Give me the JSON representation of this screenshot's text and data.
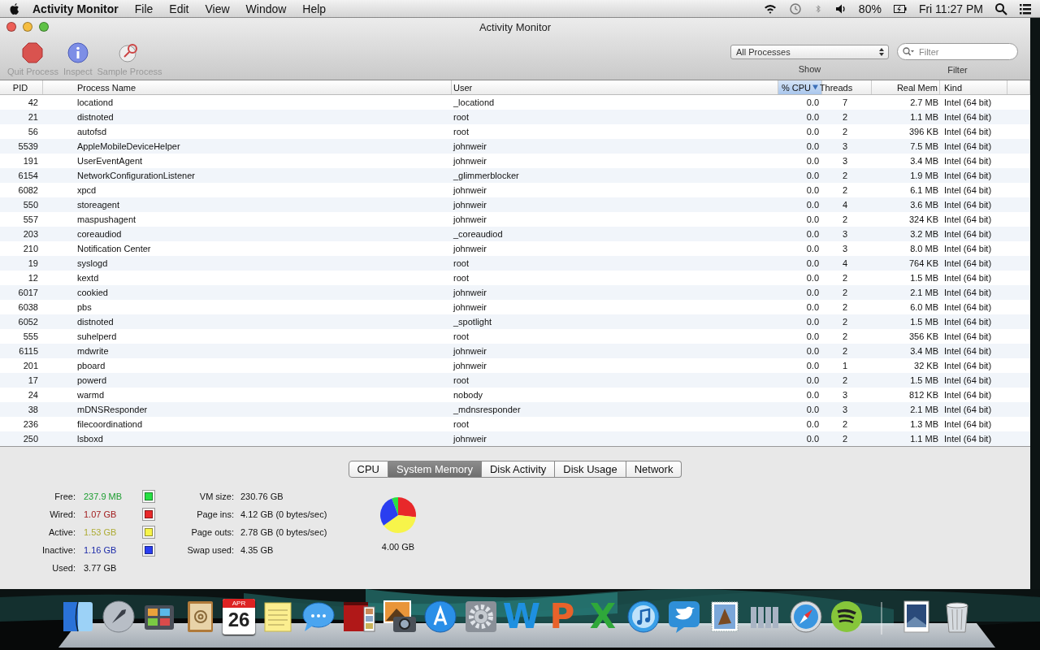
{
  "menu_bar": {
    "app_name": "Activity Monitor",
    "menus": [
      "File",
      "Edit",
      "View",
      "Window",
      "Help"
    ],
    "battery": "80%",
    "clock": "Fri 11:27 PM"
  },
  "window": {
    "title": "Activity Monitor"
  },
  "toolbar": {
    "buttons": [
      {
        "label": "Quit Process",
        "kind": "quit",
        "disabled": true
      },
      {
        "label": "Inspect",
        "kind": "inspect",
        "disabled": true
      },
      {
        "label": "Sample Process",
        "kind": "sample",
        "disabled": true
      }
    ],
    "show": {
      "value": "All Processes",
      "label": "Show"
    },
    "filter": {
      "placeholder": "Filter",
      "label": "Filter"
    }
  },
  "table": {
    "columns": [
      {
        "label": "PID",
        "selected": false
      },
      {
        "label": "Process Name",
        "selected": false
      },
      {
        "label": "User",
        "selected": false
      },
      {
        "label": "% CPU",
        "selected": true
      },
      {
        "label": "Threads",
        "selected": false
      },
      {
        "label": "Real Mem",
        "selected": false
      },
      {
        "label": "Kind",
        "selected": false
      }
    ],
    "rows": [
      [
        "42",
        "locationd",
        "_locationd",
        "0.0",
        "7",
        "2.7 MB",
        "Intel (64 bit)"
      ],
      [
        "21",
        "distnoted",
        "root",
        "0.0",
        "2",
        "1.1 MB",
        "Intel (64 bit)"
      ],
      [
        "56",
        "autofsd",
        "root",
        "0.0",
        "2",
        "396 KB",
        "Intel (64 bit)"
      ],
      [
        "5539",
        "AppleMobileDeviceHelper",
        "johnweir",
        "0.0",
        "3",
        "7.5 MB",
        "Intel (64 bit)"
      ],
      [
        "191",
        "UserEventAgent",
        "johnweir",
        "0.0",
        "3",
        "3.4 MB",
        "Intel (64 bit)"
      ],
      [
        "6154",
        "NetworkConfigurationListener",
        "_glimmerblocker",
        "0.0",
        "2",
        "1.9 MB",
        "Intel (64 bit)"
      ],
      [
        "6082",
        "xpcd",
        "johnweir",
        "0.0",
        "2",
        "6.1 MB",
        "Intel (64 bit)"
      ],
      [
        "550",
        "storeagent",
        "johnweir",
        "0.0",
        "4",
        "3.6 MB",
        "Intel (64 bit)"
      ],
      [
        "557",
        "maspushagent",
        "johnweir",
        "0.0",
        "2",
        "324 KB",
        "Intel (64 bit)"
      ],
      [
        "203",
        "coreaudiod",
        "_coreaudiod",
        "0.0",
        "3",
        "3.2 MB",
        "Intel (64 bit)"
      ],
      [
        "210",
        "Notification Center",
        "johnweir",
        "0.0",
        "3",
        "8.0 MB",
        "Intel (64 bit)"
      ],
      [
        "19",
        "syslogd",
        "root",
        "0.0",
        "4",
        "764 KB",
        "Intel (64 bit)"
      ],
      [
        "12",
        "kextd",
        "root",
        "0.0",
        "2",
        "1.5 MB",
        "Intel (64 bit)"
      ],
      [
        "6017",
        "cookied",
        "johnweir",
        "0.0",
        "2",
        "2.1 MB",
        "Intel (64 bit)"
      ],
      [
        "6038",
        "pbs",
        "johnweir",
        "0.0",
        "2",
        "6.0 MB",
        "Intel (64 bit)"
      ],
      [
        "6052",
        "distnoted",
        "_spotlight",
        "0.0",
        "2",
        "1.5 MB",
        "Intel (64 bit)"
      ],
      [
        "555",
        "suhelperd",
        "root",
        "0.0",
        "2",
        "356 KB",
        "Intel (64 bit)"
      ],
      [
        "6115",
        "mdwrite",
        "johnweir",
        "0.0",
        "2",
        "3.4 MB",
        "Intel (64 bit)"
      ],
      [
        "201",
        "pboard",
        "johnweir",
        "0.0",
        "1",
        "32 KB",
        "Intel (64 bit)"
      ],
      [
        "17",
        "powerd",
        "root",
        "0.0",
        "2",
        "1.5 MB",
        "Intel (64 bit)"
      ],
      [
        "24",
        "warmd",
        "nobody",
        "0.0",
        "3",
        "812 KB",
        "Intel (64 bit)"
      ],
      [
        "38",
        "mDNSResponder",
        "_mdnsresponder",
        "0.0",
        "3",
        "2.1 MB",
        "Intel (64 bit)"
      ],
      [
        "236",
        "filecoordinationd",
        "root",
        "0.0",
        "2",
        "1.3 MB",
        "Intel (64 bit)"
      ],
      [
        "250",
        "lsboxd",
        "johnweir",
        "0.0",
        "2",
        "1.1 MB",
        "Intel (64 bit)"
      ]
    ]
  },
  "monitor_tabs": [
    {
      "label": "CPU",
      "selected": false
    },
    {
      "label": "System Memory",
      "selected": true
    },
    {
      "label": "Disk Activity",
      "selected": false
    },
    {
      "label": "Disk Usage",
      "selected": false
    },
    {
      "label": "Network",
      "selected": false
    }
  ],
  "memory": {
    "stats": [
      {
        "label": "Free:",
        "value": "237.9 MB",
        "color": "#27e043"
      },
      {
        "label": "Wired:",
        "value": "1.07 GB",
        "color": "#e8282a"
      },
      {
        "label": "Active:",
        "value": "1.53 GB",
        "color": "#f7f44a"
      },
      {
        "label": "Inactive:",
        "value": "1.16 GB",
        "color": "#2a3ef0"
      },
      {
        "label": "Used:",
        "value": "3.77 GB"
      }
    ],
    "vm_stats": [
      {
        "label": "VM size:",
        "value": "230.76 GB"
      },
      {
        "label": "Page ins:",
        "value": "4.12 GB (0 bytes/sec)"
      },
      {
        "label": "Page outs:",
        "value": "2.78 GB (0 bytes/sec)"
      },
      {
        "label": "Swap used:",
        "value": "4.35 GB"
      }
    ],
    "chart_data": {
      "type": "pie",
      "values": [
        5.8,
        26.8,
        38.3,
        29.1
      ]
    },
    "total": "4.00 GB"
  },
  "dock": {
    "calendar_month": "APR",
    "calendar_day": "26",
    "app_letters": [
      "W",
      "P",
      "X"
    ]
  }
}
